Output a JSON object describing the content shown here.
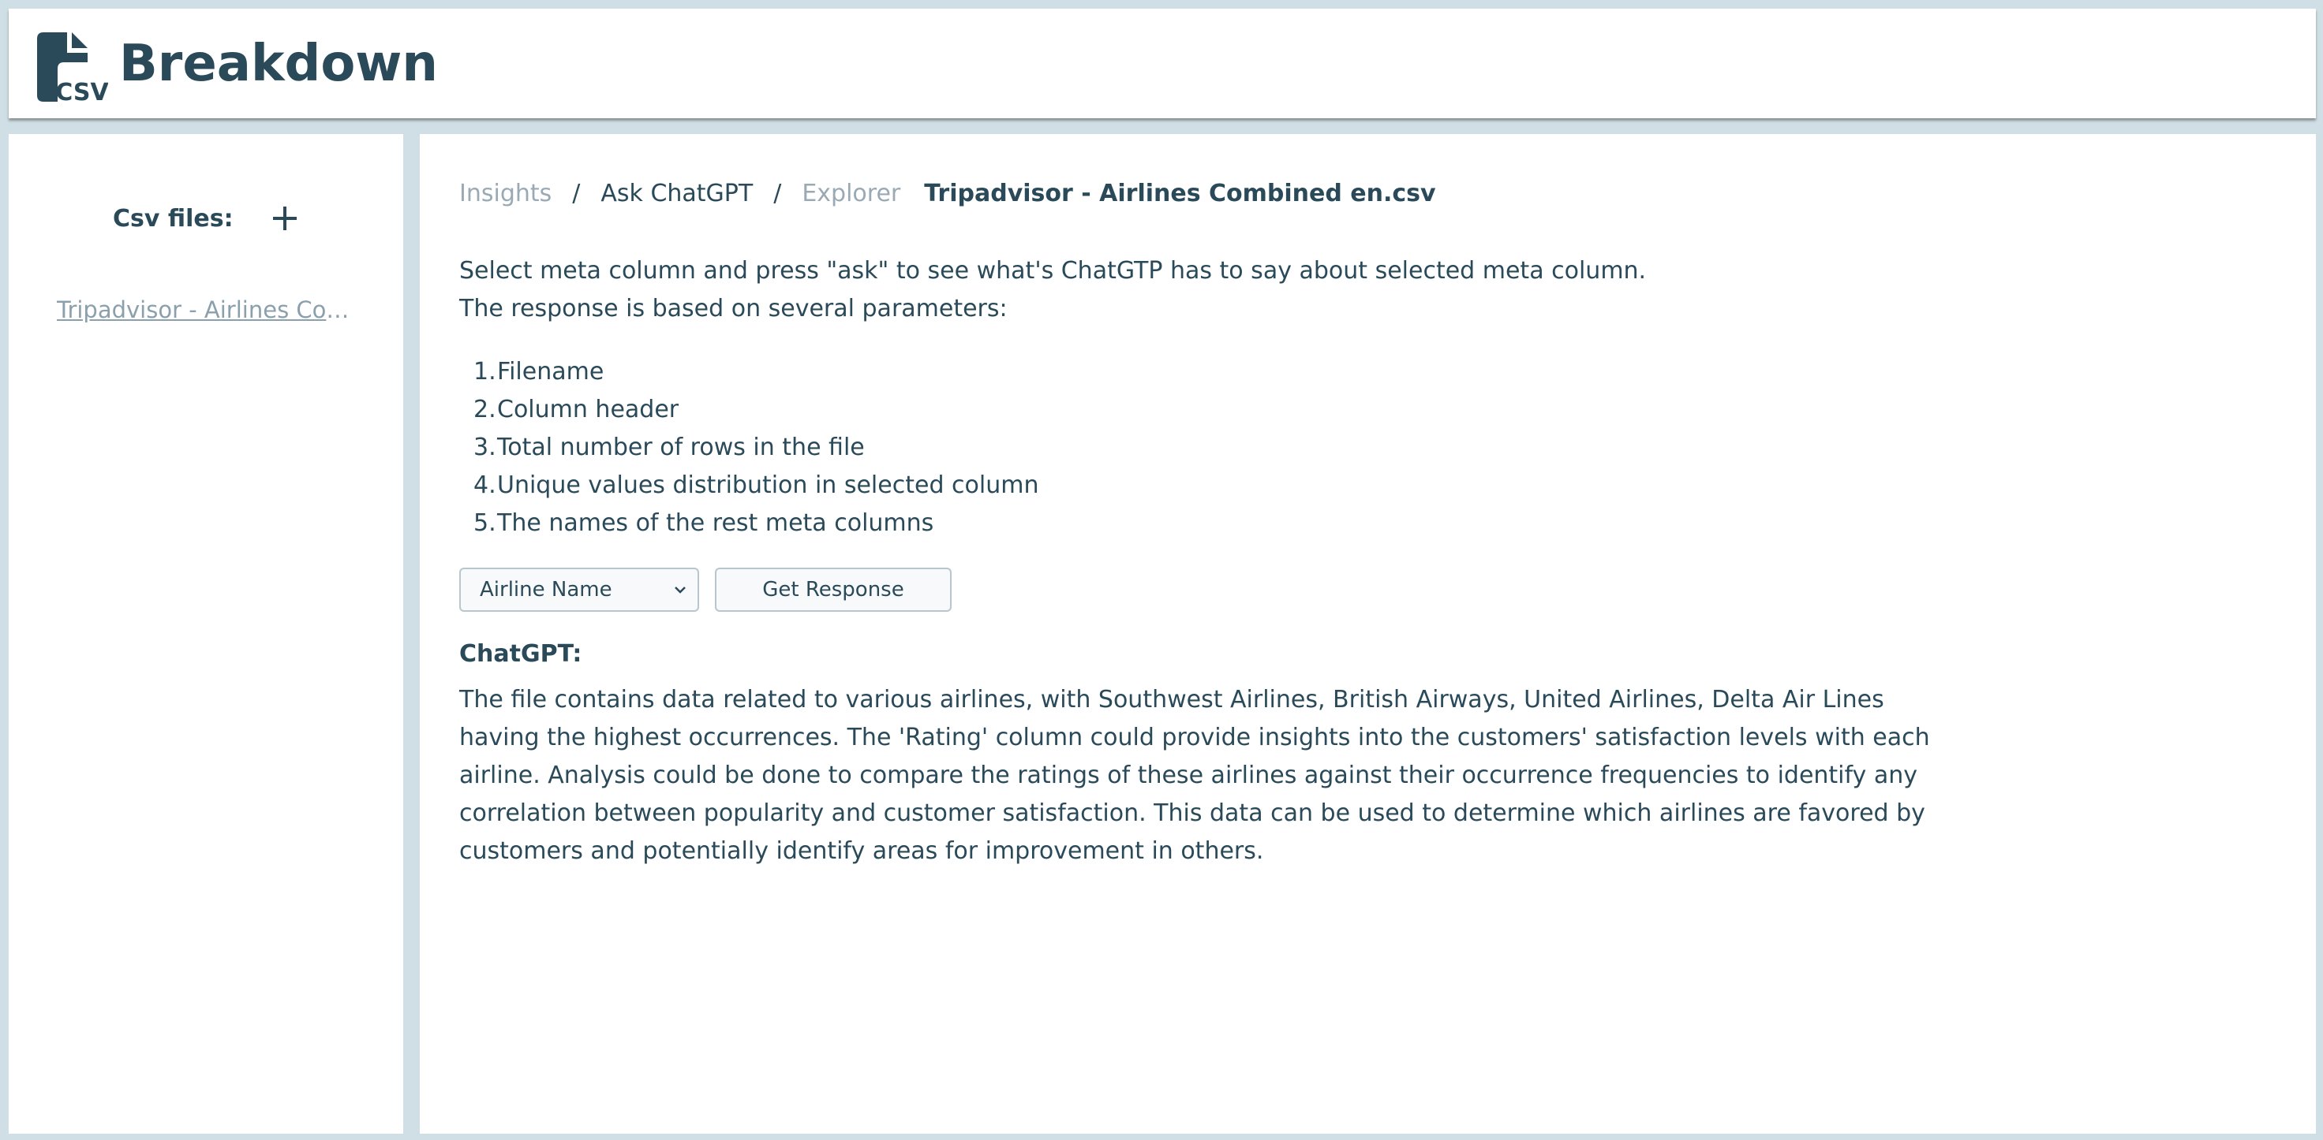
{
  "header": {
    "logo_icon": "csv-file-icon",
    "logo_text": "CSV",
    "brand": "Breakdown"
  },
  "sidebar": {
    "title": "Csv files:",
    "add_icon": "plus-icon",
    "files": [
      {
        "label": "Tripadvisor - Airlines Combined en.csv"
      }
    ]
  },
  "breadcrumb": {
    "items": [
      "Insights",
      "Ask ChatGPT",
      "Explorer"
    ],
    "separator": "/",
    "current": "Tripadvisor - Airlines Combined en.csv"
  },
  "main": {
    "intro_line1": "Select meta column and press \"ask\" to see what's ChatGTP has to say about selected meta column.",
    "intro_line2": "The response is based on several parameters:",
    "params": [
      {
        "num": "1.",
        "text": "Filename"
      },
      {
        "num": "2.",
        "text": "Column header"
      },
      {
        "num": "3.",
        "text": "Total number of rows in the file"
      },
      {
        "num": "4.",
        "text": "Unique values distribution in selected column"
      },
      {
        "num": "5.",
        "text": "The names of the rest meta columns"
      }
    ],
    "select_value": "Airline Name",
    "button_label": "Get Response",
    "response_label": "ChatGPT:",
    "response_text": "The file contains data related to various airlines, with Southwest Airlines, British Airways, United Airlines, Delta Air Lines having the highest occurrences. The 'Rating' column could provide insights into the customers' satisfaction levels with each airline. Analysis could be done to compare the ratings of these airlines against their occurrence frequencies to identify any correlation between popularity and customer satisfaction. This data can be used to determine which airlines are favored by customers and potentially identify areas for improvement in others."
  },
  "colors": {
    "background": "#cfdfe5",
    "panel": "#ffffff",
    "text": "#2a4a5a",
    "muted": "#9aaab4"
  }
}
